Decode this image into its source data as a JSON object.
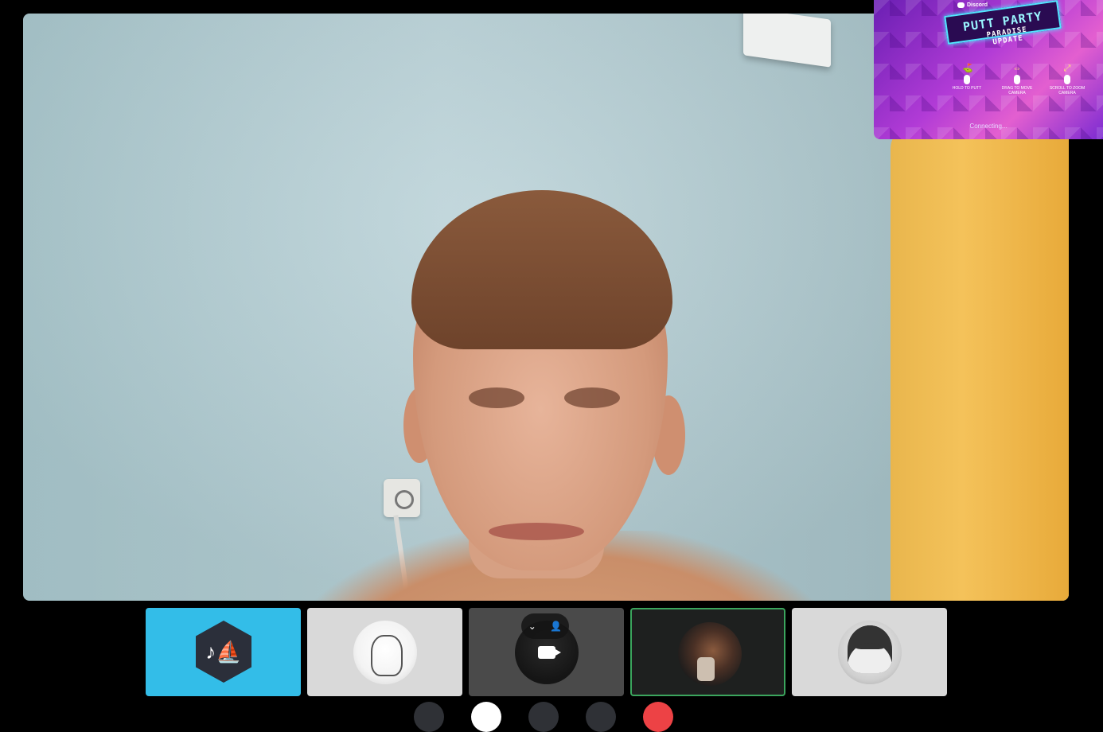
{
  "pip": {
    "brand": "Discord",
    "game_title": "PUTT PARTY",
    "game_subtitle_line1": "PARADISE",
    "game_subtitle_line2": "UPDATE",
    "controls": [
      {
        "icon": "golf-club-icon",
        "label": "HOLD TO PUTT"
      },
      {
        "icon": "move-camera-icon",
        "label": "DRAG TO MOVE CAMERA"
      },
      {
        "icon": "zoom-icon",
        "label": "SCROLL TO ZOOM CAMERA"
      }
    ],
    "status": "Connecting..."
  },
  "participants": [
    {
      "name": "music-bot",
      "bg": "#33bde8"
    },
    {
      "name": "anime-avatar",
      "bg": "#d9d9d9"
    },
    {
      "name": "camera-user",
      "bg": "#4a4a4a"
    },
    {
      "name": "baby-avatar",
      "bg": "#1e201f",
      "speaking": true
    },
    {
      "name": "bw-avatar",
      "bg": "#d9d9d9"
    }
  ],
  "colors": {
    "speaking_ring": "#3ba55d",
    "disconnect": "#ed4245"
  }
}
